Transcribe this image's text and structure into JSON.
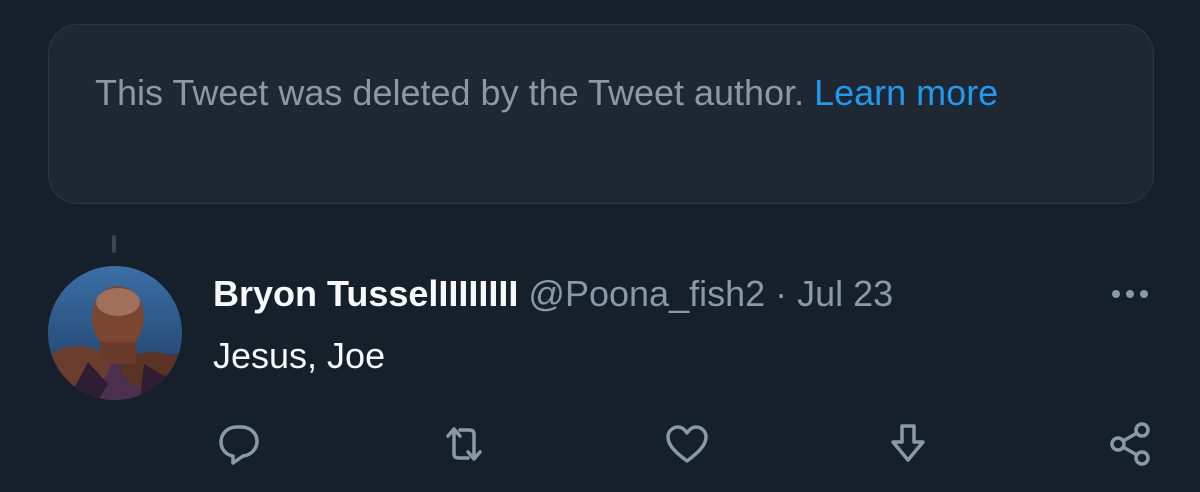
{
  "deleted_notice": {
    "text": "This Tweet was deleted by the Tweet author. ",
    "link_label": "Learn more"
  },
  "tweet": {
    "display_name": "Bryon TusselIIIIIIII",
    "handle": "@Poona_fish2",
    "separator": " · ",
    "date": "Jul 23",
    "text": "Jesus, Joe",
    "avatar_icon": "avatar-photo"
  },
  "actions": {
    "reply_icon": "reply-icon",
    "retweet_icon": "retweet-icon",
    "like_icon": "heart-icon",
    "download_icon": "download-icon",
    "share_icon": "share-icon",
    "more_icon": "more-icon"
  },
  "colors": {
    "background": "#15202b",
    "card": "#1e2732",
    "link": "#1d9bf0",
    "muted": "#8b98a5",
    "text": "#f7f9f9"
  }
}
